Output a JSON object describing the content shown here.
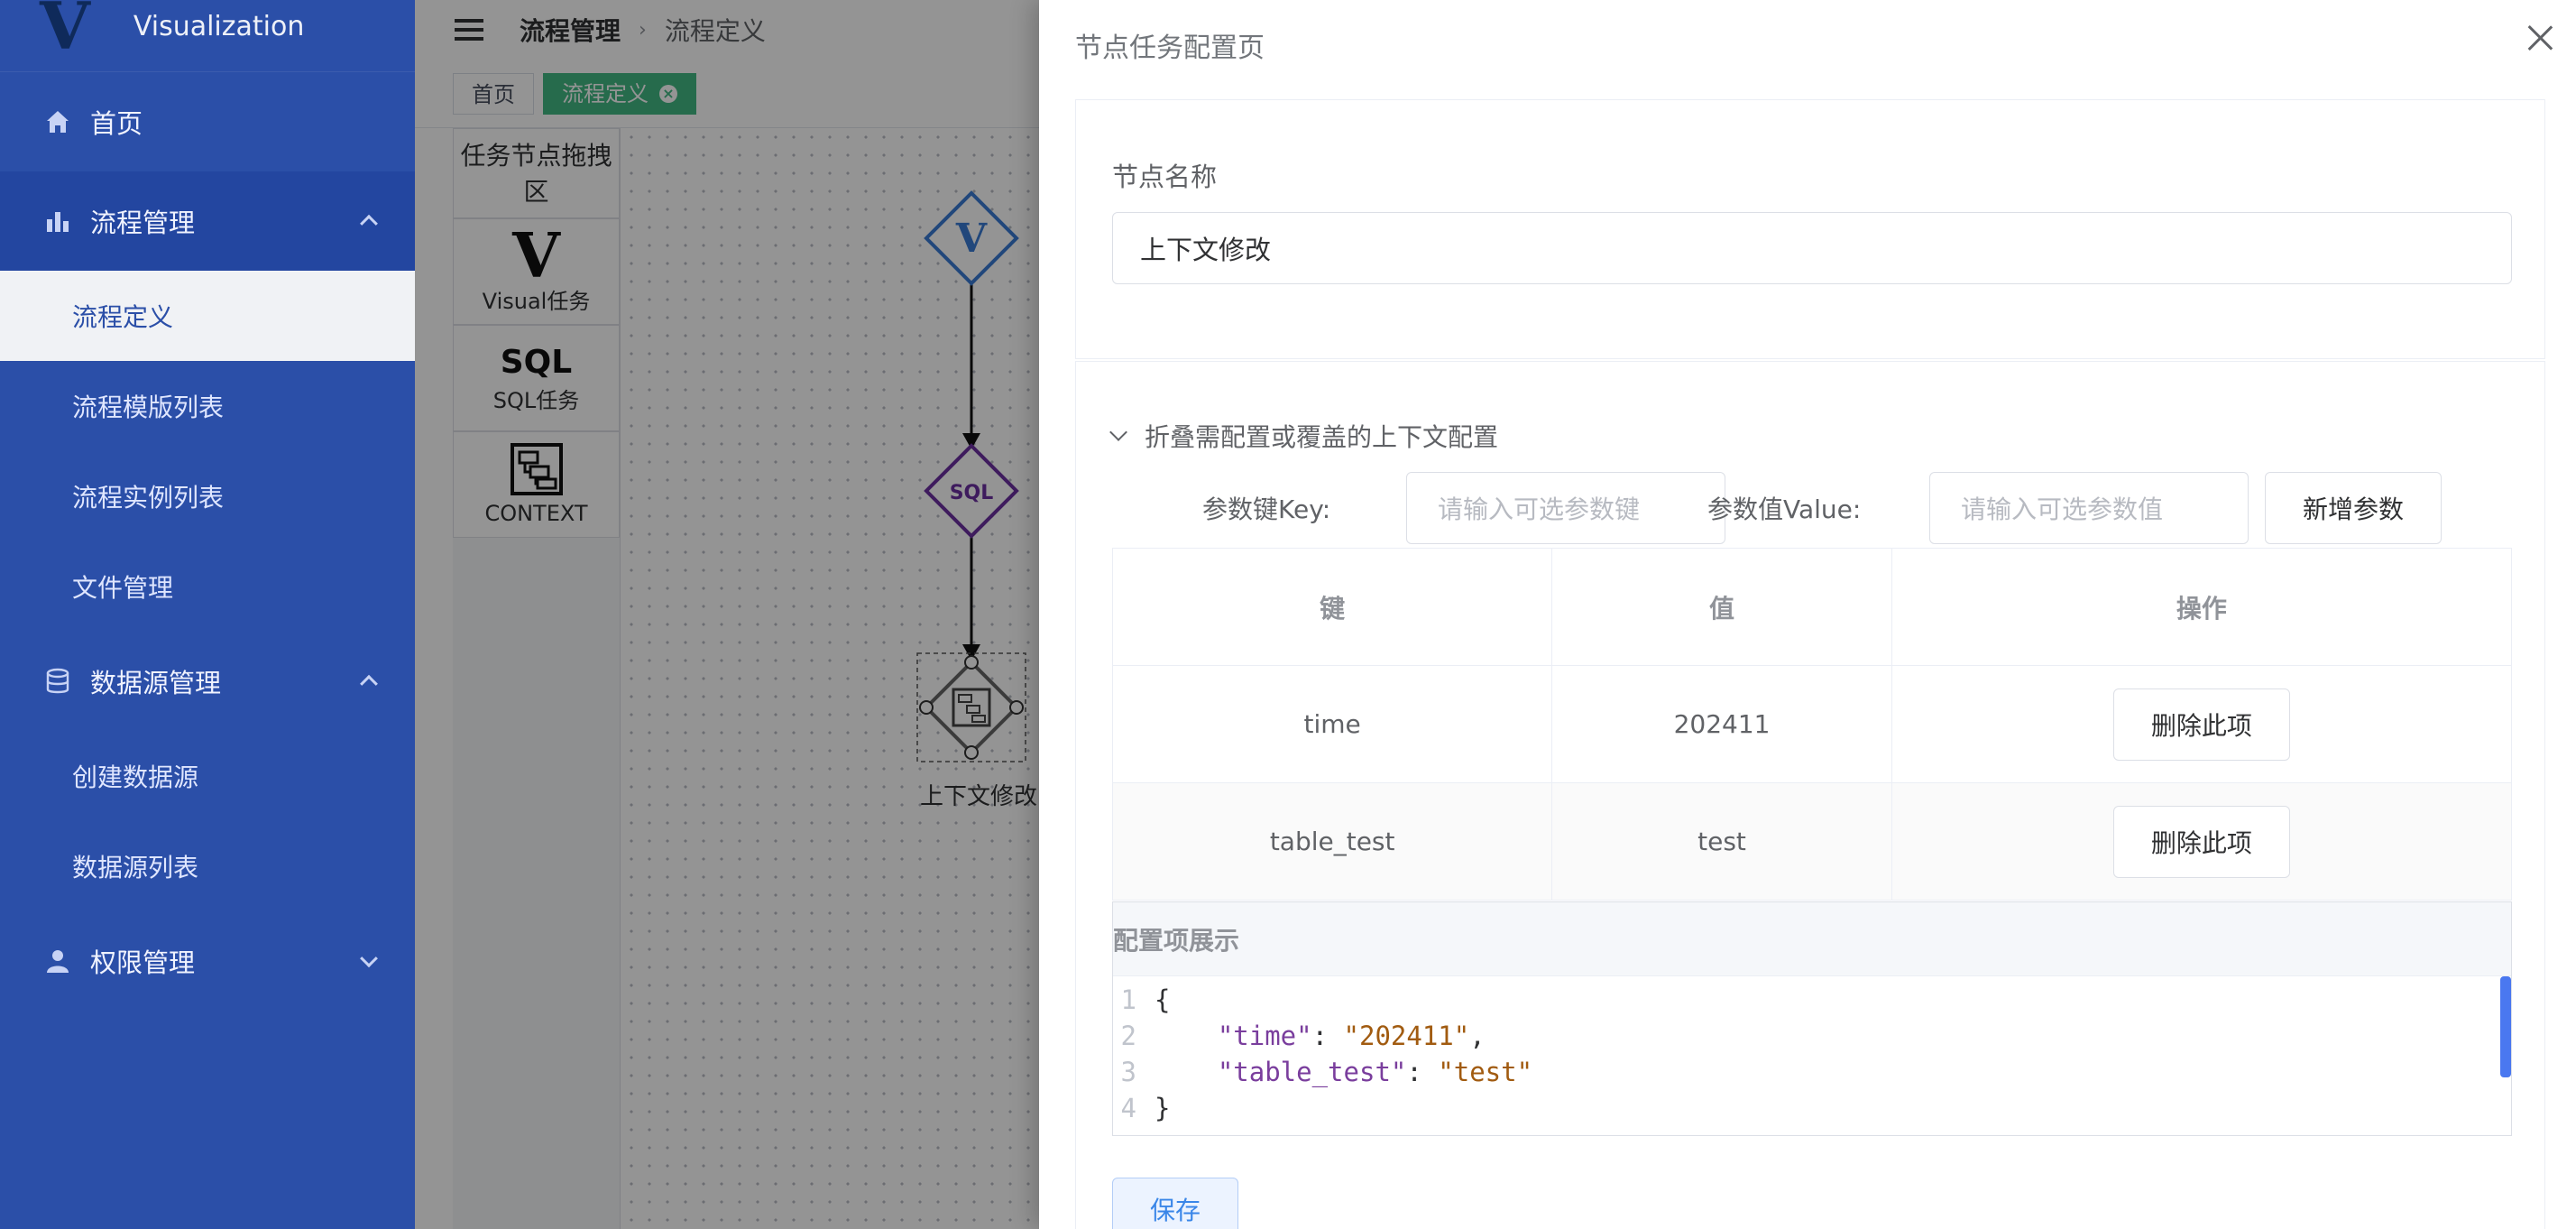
{
  "app": {
    "name": "Visualization",
    "logo_letter": "V"
  },
  "sidebar": {
    "items": [
      {
        "label": "首页",
        "icon": "home-icon"
      },
      {
        "label": "流程管理",
        "icon": "bar-chart-icon",
        "expanded": true,
        "children": [
          {
            "label": "流程定义",
            "active": true
          },
          {
            "label": "流程模版列表"
          },
          {
            "label": "流程实例列表"
          },
          {
            "label": "文件管理"
          }
        ]
      },
      {
        "label": "数据源管理",
        "icon": "database-icon",
        "expanded": true,
        "children": [
          {
            "label": "创建数据源"
          },
          {
            "label": "数据源列表"
          }
        ]
      },
      {
        "label": "权限管理",
        "icon": "user-icon",
        "expanded": false
      }
    ]
  },
  "header": {
    "breadcrumb": [
      "流程管理",
      "流程定义"
    ]
  },
  "tabs": [
    {
      "label": "首页"
    },
    {
      "label": "流程定义",
      "active": true
    }
  ],
  "palette": {
    "title": "任务节点拖拽区",
    "items": [
      {
        "glyph": "V",
        "label": "Visual任务"
      },
      {
        "glyph": "SQL",
        "label": "SQL任务"
      },
      {
        "glyph": "",
        "label": "CONTEXT"
      }
    ]
  },
  "canvas": {
    "nodes": [
      {
        "glyph": "V"
      },
      {
        "glyph": "SQL"
      },
      {
        "label": "上下文修改"
      }
    ]
  },
  "drawer": {
    "title": "节点任务配置页",
    "node_name_label": "节点名称",
    "node_name_value": "上下文修改",
    "collapse_title": "折叠需配置或覆盖的上下文配置",
    "param_key_label": "参数键Key:",
    "param_key_placeholder": "请输入可选参数键",
    "param_value_label": "参数值Value:",
    "param_value_placeholder": "请输入可选参数值",
    "add_button": "新增参数",
    "table": {
      "headers": [
        "键",
        "值",
        "操作"
      ],
      "rows": [
        {
          "key": "time",
          "value": "202411",
          "action": "删除此项"
        },
        {
          "key": "table_test",
          "value": "test",
          "action": "删除此项"
        }
      ]
    },
    "preview": {
      "title": "配置项展示",
      "line_numbers": [
        "1",
        "2",
        "3",
        "4"
      ],
      "open": "{",
      "close": "}",
      "entries": [
        {
          "key": "\"time\"",
          "value": "\"202411\"",
          "trail": ","
        },
        {
          "key": "\"table_test\"",
          "value": "\"test\"",
          "trail": ""
        }
      ]
    },
    "save_button": "保存"
  },
  "colors": {
    "sidebar": "#2b4fa8",
    "accent_tag": "#42b983",
    "primary": "#409eff",
    "sql_purple": "#6b2fa0",
    "visual_blue": "#3a7bd5"
  }
}
